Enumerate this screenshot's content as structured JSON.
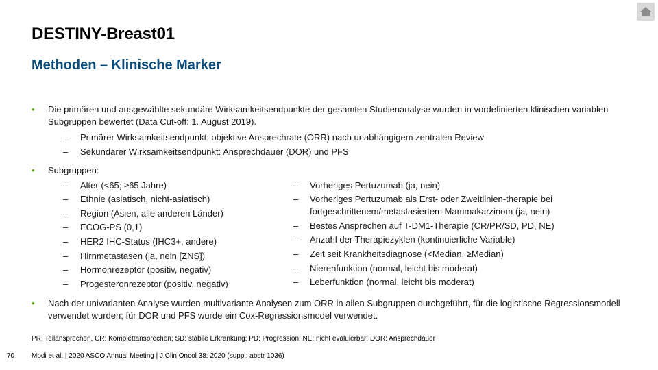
{
  "nav": {
    "home_icon": "home-icon"
  },
  "title": "DESTINY-Breast01",
  "subtitle": "Methoden – Klinische Marker",
  "bullets": {
    "b1": "Die primären und ausgewählte sekundäre Wirksamkeitsendpunkte der gesamten Studienanalyse wurden in vordefinierten klinischen variablen Subgruppen bewertet (Data Cut-off: 1. August 2019).",
    "b1_sub": [
      "Primärer Wirksamkeitsendpunkt: objektive Ansprechrate (ORR) nach unabhängigem zentralen Review",
      "Sekundärer Wirksamkeitsendpunkt: Ansprechdauer (DOR) und PFS"
    ],
    "b2": "Subgruppen:",
    "b2_left": [
      "Alter (<65; ≥65 Jahre)",
      "Ethnie (asiatisch, nicht-asiatisch)",
      "Region (Asien, alle anderen Länder)",
      "ECOG-PS (0,1)",
      "HER2 IHC-Status (IHC3+, andere)",
      "Hirnmetastasen (ja, nein [ZNS])",
      "Hormonrezeptor (positiv, negativ)",
      "Progesteronrezeptor (positiv, negativ)"
    ],
    "b2_right": [
      "Vorheriges Pertuzumab (ja, nein)",
      "Vorheriges Pertuzumab als Erst- oder Zweitlinien-therapie bei fortgeschrittenem/metastasiertem Mammakarzinom (ja, nein)",
      "Bestes Ansprechen auf T-DM1-Therapie (CR/PR/SD, PD, NE)",
      "Anzahl der Therapiezyklen (kontinuierliche Variable)",
      "Zeit seit Krankheitsdiagnose (<Median, ≥Median)",
      "Nierenfunktion (normal, leicht bis moderat)",
      "Leberfunktion (normal, leicht bis moderat)"
    ],
    "b3": "Nach der univarianten Analyse wurden multivariante Analysen zum ORR in allen Subgruppen durchgeführt, für die logistische Regressionsmodell verwendet wurden; für DOR und PFS wurde ein Cox-Regressionsmodel verwendet."
  },
  "bullet_symbol": "•",
  "dash_symbol": "–",
  "footnote": "PR: Teilansprechen, CR: Komplettansprechen; SD: stabile Erkrankung; PD: Progression; NE: nicht evaluierbar; DOR: Ansprechdauer",
  "page_number": "70",
  "citation": "Modi et al. | 2020 ASCO Annual Meeting | J Clin Oncol 38: 2020 (suppl; abstr 1036)",
  "colors": {
    "accent": "#6ab023",
    "subtitle": "#0b4d7a"
  }
}
